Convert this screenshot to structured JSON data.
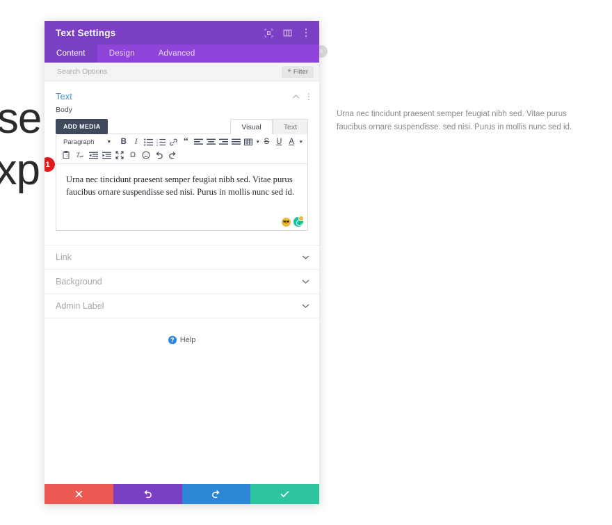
{
  "page": {
    "heading_line1": "r se",
    "heading_line2": "exp",
    "paragraph": "Urna nec tincidunt praesent semper feugiat nibh sed. Vitae purus faucibus ornare suspendisse. sed nisi. Purus in mollis nunc sed id.",
    "ghost_close": "×"
  },
  "modal": {
    "title": "Text Settings",
    "title_icons": [
      {
        "name": "expand-icon"
      },
      {
        "name": "layout-columns-icon"
      },
      {
        "name": "more-vertical-icon"
      }
    ],
    "tabs": [
      {
        "label": "Content",
        "active": true
      },
      {
        "label": "Design",
        "active": false
      },
      {
        "label": "Advanced",
        "active": false
      }
    ],
    "search": {
      "placeholder": "Search Options",
      "value": ""
    },
    "filter_button": {
      "plus": "+",
      "label": "Filter"
    },
    "text_section": {
      "title": "Text",
      "field_label": "Body",
      "add_media_label": "ADD MEDIA",
      "editor_tabs": [
        {
          "label": "Visual",
          "active": true
        },
        {
          "label": "Text",
          "active": false
        }
      ],
      "format_select": {
        "value": "Paragraph"
      },
      "toolbar_row1": [
        {
          "name": "bold-icon",
          "glyph": "B"
        },
        {
          "name": "italic-icon",
          "glyph": "I"
        },
        {
          "name": "bulleted-list-icon"
        },
        {
          "name": "numbered-list-icon"
        },
        {
          "name": "link-icon"
        },
        {
          "name": "blockquote-icon",
          "glyph": "“"
        },
        {
          "name": "align-left-icon"
        },
        {
          "name": "align-center-icon"
        },
        {
          "name": "align-right-icon"
        },
        {
          "name": "align-justify-icon"
        },
        {
          "name": "table-icon"
        },
        {
          "name": "strikethrough-icon",
          "glyph": "S"
        },
        {
          "name": "underline-icon",
          "glyph": "U"
        },
        {
          "name": "text-color-icon",
          "glyph": "A"
        }
      ],
      "toolbar_row2": [
        {
          "name": "paste-as-text-icon"
        },
        {
          "name": "clear-formatting-icon"
        },
        {
          "name": "outdent-icon"
        },
        {
          "name": "indent-icon"
        },
        {
          "name": "fullscreen-icon"
        },
        {
          "name": "special-character-icon",
          "glyph": "Ω"
        },
        {
          "name": "emoji-icon"
        },
        {
          "name": "undo-icon"
        },
        {
          "name": "redo-icon"
        }
      ],
      "body_text": "Urna nec tincidunt praesent semper feugiat nibh sed. Vitae purus faucibus ornare suspendisse sed nisi. Purus in mollis nunc sed id.",
      "badges": [
        {
          "name": "emoji-badge-icon"
        },
        {
          "name": "grammarly-badge-icon"
        }
      ],
      "step_badge": "1"
    },
    "collapsed_sections": [
      {
        "label": "Link",
        "name": "link"
      },
      {
        "label": "Background",
        "name": "background"
      },
      {
        "label": "Admin Label",
        "name": "admin-label"
      }
    ],
    "help": {
      "icon_glyph": "?",
      "label": "Help"
    },
    "footer_buttons": [
      {
        "name": "cancel-button",
        "icon": "close-icon"
      },
      {
        "name": "undo-button",
        "icon": "undo-icon"
      },
      {
        "name": "redo-button",
        "icon": "redo-icon"
      },
      {
        "name": "save-button",
        "icon": "check-icon"
      }
    ]
  },
  "colors": {
    "accent_purple": "#7b3fc4",
    "tab_purple": "#8e44d8",
    "section_blue": "#4a8fd1",
    "badge_red": "#e01b1b",
    "save_teal": "#2ec4a0",
    "redo_blue": "#2e87d6",
    "cancel_red": "#ec5b53"
  }
}
